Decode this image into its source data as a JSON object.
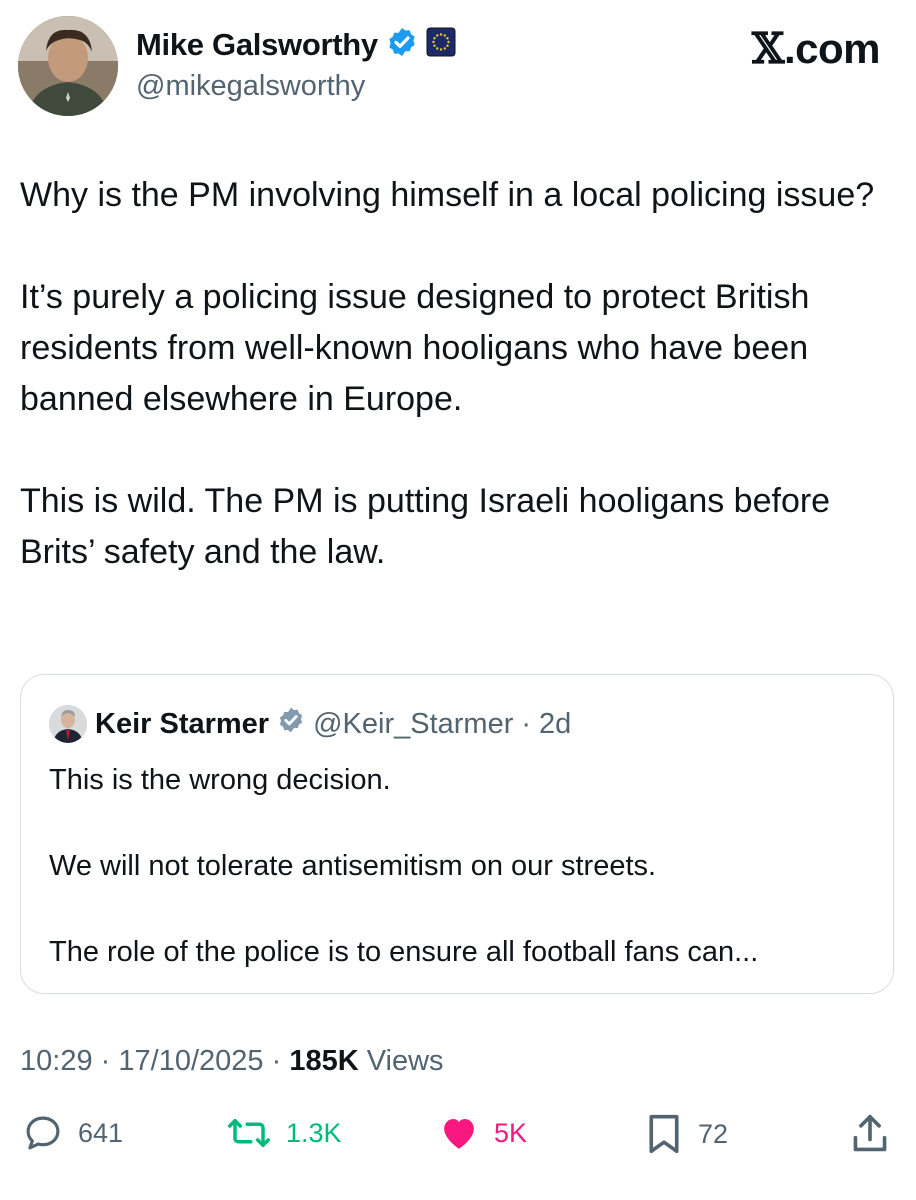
{
  "author": {
    "display_name": "Mike Galsworthy",
    "handle": "@mikegalsworthy",
    "verified_icon": "verified-badge-icon",
    "affiliate_badge": "eu-flag-badge-icon"
  },
  "brand": {
    "x_glyph": "𝕏",
    "suffix": ".com"
  },
  "tweet": {
    "paragraphs": [
      "Why is the PM involving himself in a local policing issue?",
      "It’s purely a policing issue designed to protect British residents from well-known hooligans who have been banned elsewhere in Europe.",
      "This is wild. The PM is putting Israeli hooligans before Brits’ safety and the law."
    ]
  },
  "quoted": {
    "display_name": "Keir Starmer",
    "handle": "@Keir_Starmer",
    "separator": "·",
    "age": "2d",
    "paragraphs": [
      "This is the wrong decision.",
      "We will not tolerate antisemitism on our streets.",
      "The role of the police is to ensure all football fans can..."
    ]
  },
  "meta": {
    "time": "10:29",
    "sep1": "·",
    "date": "17/10/2025",
    "sep2": "·",
    "views_count": "185K",
    "views_label": "Views"
  },
  "actions": {
    "replies": "641",
    "reposts": "1.3K",
    "likes": "5K",
    "bookmarks": "72"
  },
  "colors": {
    "verified_blue": "#1d9bf0",
    "repost_green": "#00ba7c",
    "like_pink": "#f91880",
    "muted": "#536471",
    "eu_blue": "#1c2a6b",
    "eu_gold": "#f4c81b"
  }
}
